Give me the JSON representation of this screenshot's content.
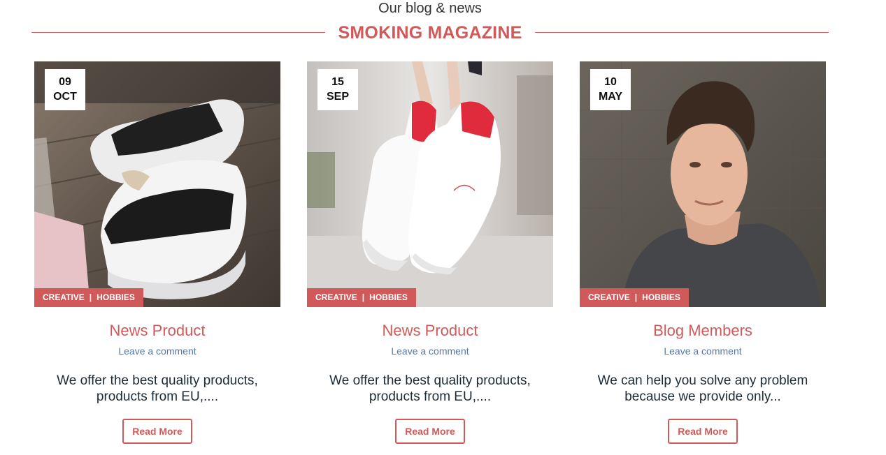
{
  "section": {
    "subtitle": "Our blog & news",
    "title": "SMOKING MAGAZINE"
  },
  "colors": {
    "accent": "#d05a5a",
    "link": "#4d7ba8",
    "text": "#1c2b36"
  },
  "posts": [
    {
      "day": "09",
      "month": "OCT",
      "cat1": "CREATIVE",
      "cat_sep": "|",
      "cat2": "HOBBIES",
      "title": "News Product",
      "comment": "Leave a comment",
      "excerpt": "We offer the best quality products, products from EU,....",
      "button": "Read More",
      "image": "white-black-sneakers-photo"
    },
    {
      "day": "15",
      "month": "SEP",
      "cat1": "CREATIVE",
      "cat_sep": "|",
      "cat2": "HOBBIES",
      "title": "News Product",
      "comment": "Leave a comment",
      "excerpt": "We offer the best quality products, products from EU,....",
      "button": "Read More",
      "image": "white-red-sneakers-photo"
    },
    {
      "day": "10",
      "month": "MAY",
      "cat1": "CREATIVE",
      "cat_sep": "|",
      "cat2": "HOBBIES",
      "title": "Blog Members",
      "comment": "Leave a comment",
      "excerpt": "We can help you solve any problem because we provide only...",
      "button": "Read More",
      "image": "man-portrait-photo"
    }
  ]
}
